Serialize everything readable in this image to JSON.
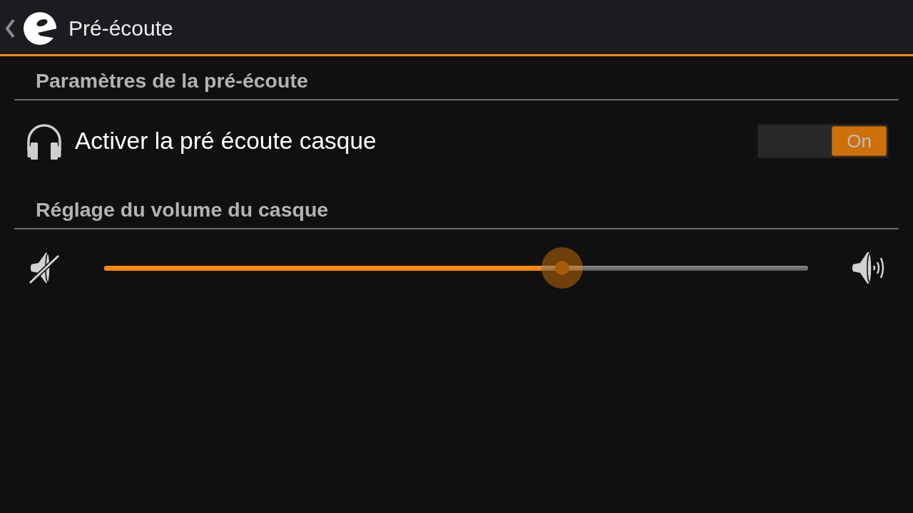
{
  "app_bar": {
    "title": "Pré-écoute"
  },
  "sections": [
    {
      "title": "Paramètres de la pré-écoute",
      "items": [
        {
          "kind": "switch",
          "label": "Activer la pré écoute casque",
          "on": true,
          "state_label": "On"
        }
      ]
    },
    {
      "title": "Réglage du volume du casque",
      "items": [
        {
          "kind": "slider",
          "level": 0.65
        }
      ]
    }
  ]
}
